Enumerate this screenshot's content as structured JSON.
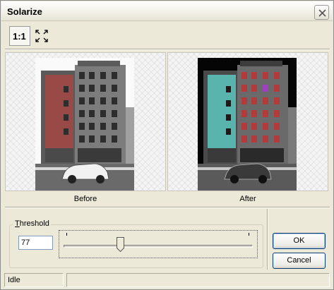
{
  "window": {
    "title": "Solarize"
  },
  "toolbar": {
    "actual_size_label": "1:1",
    "fit_icon": "fit-to-window-icon"
  },
  "preview": {
    "before_caption": "Before",
    "after_caption": "After"
  },
  "threshold": {
    "label_prefix": "",
    "label_accel": "T",
    "label_rest": "hreshold",
    "value": "77",
    "slider_fraction": 0.302
  },
  "buttons": {
    "ok_label": "OK",
    "cancel_label": "Cancel"
  },
  "status": {
    "text": "Idle",
    "text2": ""
  },
  "colors": {
    "window_bg": "#ece9d8",
    "button_border": "#003c74"
  }
}
